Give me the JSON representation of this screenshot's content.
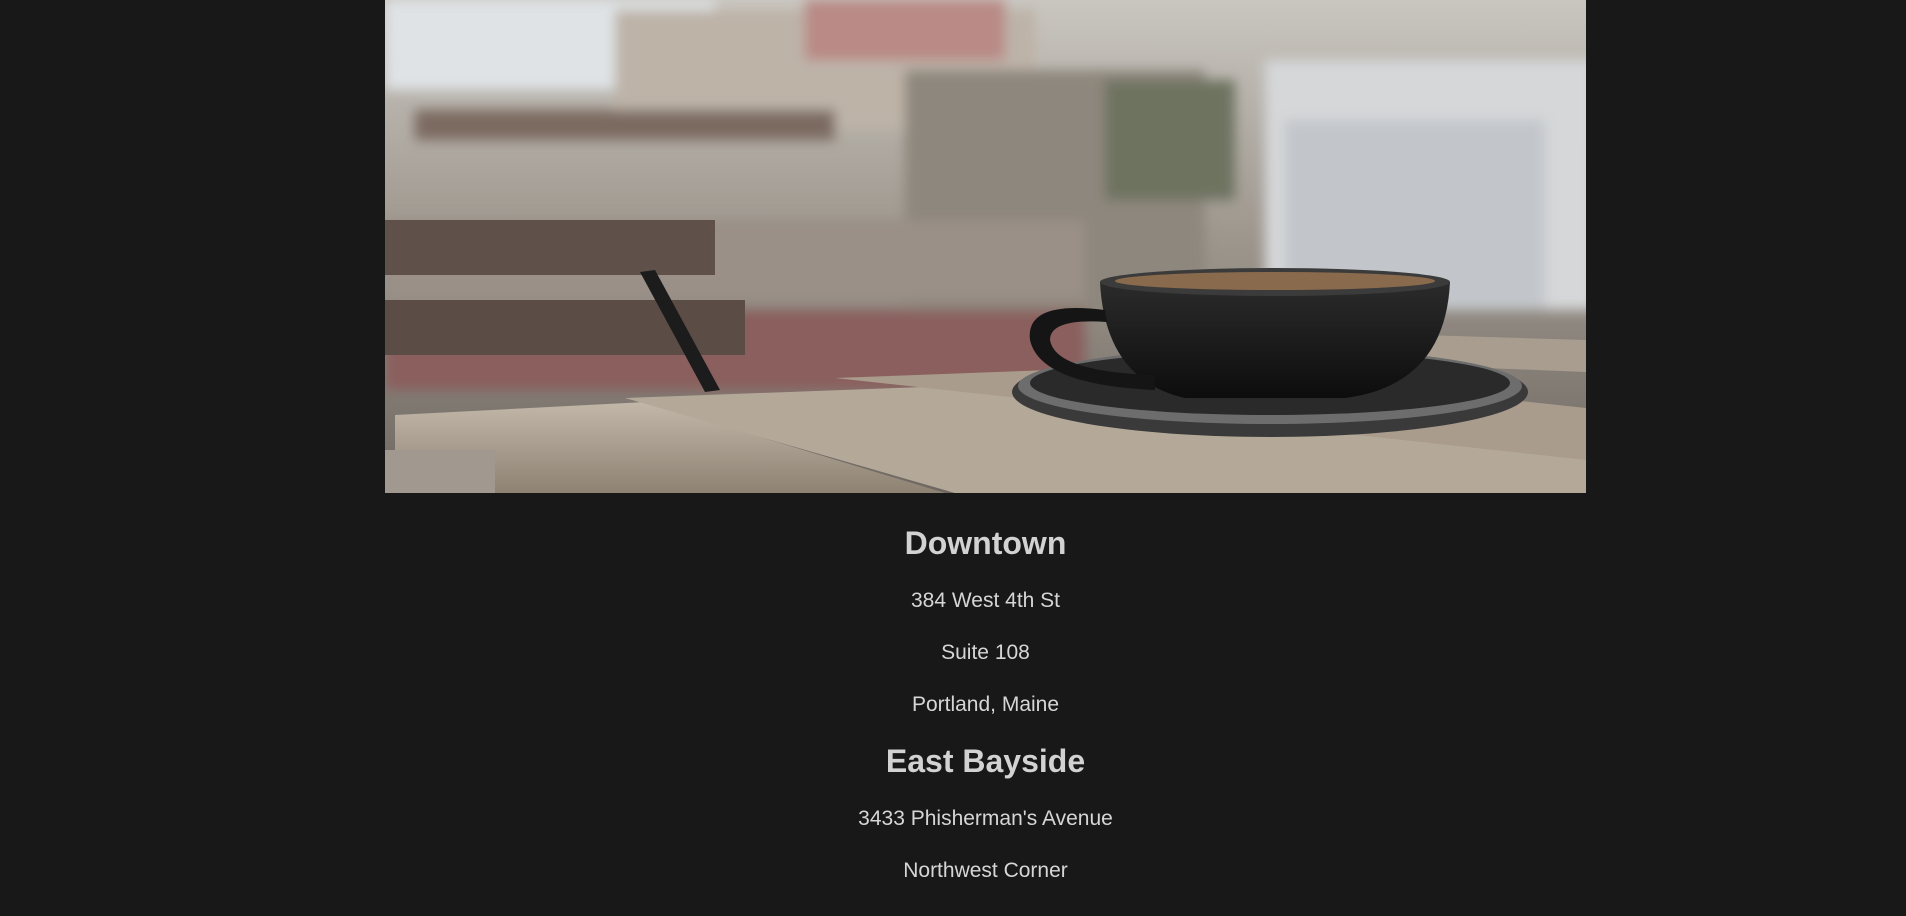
{
  "colors": {
    "background": "#181818",
    "text": "#d6d6d6"
  },
  "hero": {
    "image": "coffee-cup-on-wooden-table-photo"
  },
  "locations": [
    {
      "name": "Downtown",
      "lines": [
        "384 West 4th St",
        "Suite 108",
        "Portland, Maine"
      ]
    },
    {
      "name": "East Bayside",
      "lines": [
        "3433 Phisherman's Avenue",
        "Northwest Corner"
      ]
    }
  ]
}
